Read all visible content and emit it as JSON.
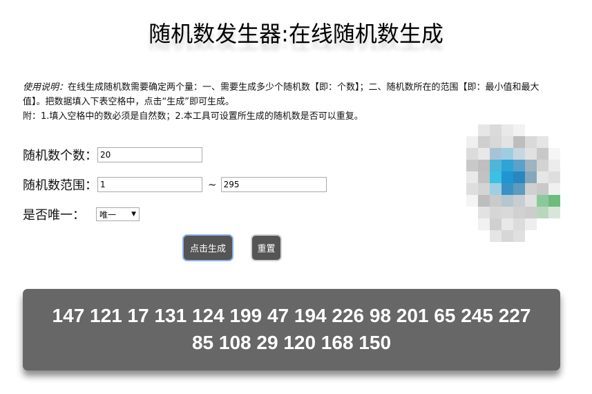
{
  "page_title": "随机数发生器:在线随机数生成",
  "description": {
    "intro_label": "使用说明：",
    "line1_rest": "在线生成随机数需要确定两个量：一、需要生成多少个随机数【即：个数】；二、随机数所在的范围【即：最小值和最大值】。把数据填入下表空格中，点击“生成”即可生成。",
    "line2": "附：1.填入空格中的数必须是自然数；2.本工具可设置所生成的随机数是否可以重复。"
  },
  "form": {
    "count_label": "随机数个数：",
    "count_value": "20",
    "range_label": "随机数范围：",
    "range_min": "1",
    "range_separator": "~",
    "range_max": "295",
    "unique_label": "是否唯一：",
    "unique_selected": "唯一",
    "unique_arrow": "▼"
  },
  "buttons": {
    "generate_label": "点击生成",
    "reset_label": "重置"
  },
  "result": {
    "numbers_text": "147 121 17 131 124 199 47 194 226 98 201 65 245 227 85 108 29 120 168 150"
  },
  "qr_pixels": [
    "#ffffff",
    "#e6e6e6",
    "#dadada",
    "#e9e9e9",
    "#f2f2f2",
    "#ffffff",
    "#ffffff",
    "#ffffff",
    "#f0f0f0",
    "#cfcfcf",
    "#d8d8d8",
    "#e3e3e3",
    "#bdbdbd",
    "#d9d9d9",
    "#e5e5e5",
    "#ffffff",
    "#dcdcdc",
    "#e8e8e8",
    "#a9c3d6",
    "#9ecde0",
    "#c8d6df",
    "#e1e1e1",
    "#c8c8c8",
    "#f5f5f5",
    "#c9c9c9",
    "#bfbfbf",
    "#4eb6d8",
    "#2fa3d6",
    "#5aa2c9",
    "#9fb3c0",
    "#d3d3d3",
    "#ececec",
    "#e9e9e9",
    "#c2c2c2",
    "#3ac1e3",
    "#1f95d1",
    "#2a86c0",
    "#86a7bb",
    "#e6e6e6",
    "#dedede",
    "#dedede",
    "#d4d4d4",
    "#9ecfe2",
    "#3a92c4",
    "#5d9bbf",
    "#d0d0d0",
    "#c9c9c9",
    "#f0f0f0",
    "#f4f4f4",
    "#bdbdbd",
    "#cacaca",
    "#b5c6d1",
    "#c7cdd1",
    "#e1e1e1",
    "#8cc99a",
    "#6cbc7e",
    "#ffffff",
    "#e2e2e2",
    "#d6d6d6",
    "#d9d9d9",
    "#d1d1d1",
    "#cdcdcd",
    "#b9d7bd",
    "#d8e6d9",
    "#ffffff",
    "#f1f1f1",
    "#d0d0d0",
    "#e8e8e8",
    "#dcdcdc",
    "#eeeeee",
    "#ffffff",
    "#ffffff",
    "#ffffff",
    "#ffffff",
    "#e5e5e5",
    "#d7d7d7",
    "#e0e0e0",
    "#ffffff",
    "#ffffff",
    "#ffffff"
  ]
}
